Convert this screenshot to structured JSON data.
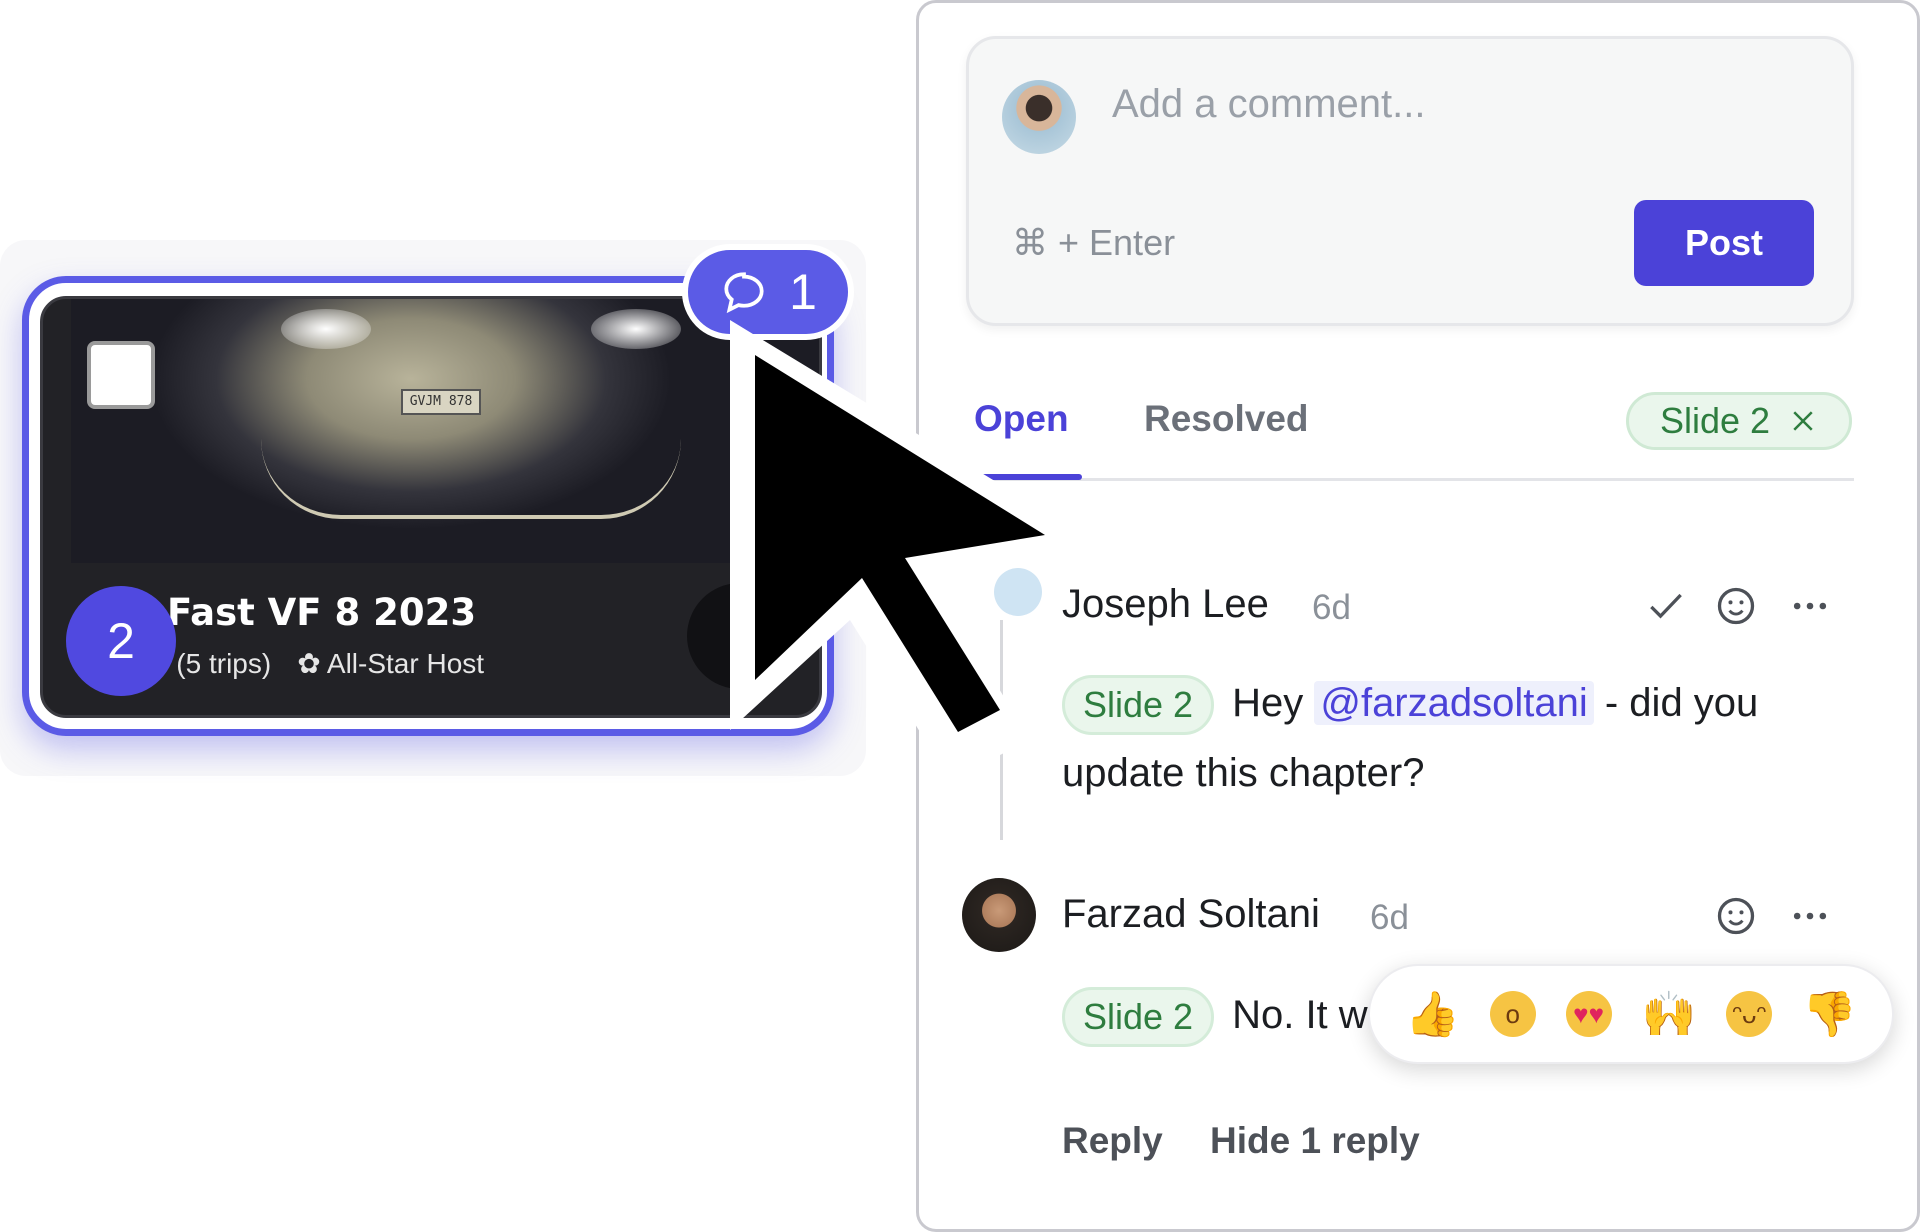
{
  "slide_card": {
    "title": "Fast VF 8 2023",
    "trips": "(5 trips)",
    "host_badge": "All-Star Host",
    "license_plate": "GVJM 878",
    "slide_number": "2",
    "comment_count": "1",
    "accent_color": "#5b5be6"
  },
  "composer": {
    "placeholder": "Add a comment...",
    "shortcut": "⌘ + Enter",
    "post_label": "Post"
  },
  "tabs": {
    "open_label": "Open",
    "resolved_label": "Resolved",
    "filter_label": "Slide 2",
    "active": "Open"
  },
  "comments": [
    {
      "author": "Joseph Lee",
      "age": "6d",
      "slide_tag": "Slide 2",
      "text_before": "Hey",
      "mention": "@farzadsoltani",
      "text_after": "- did you update this chapter?"
    },
    {
      "author": "Farzad Soltani",
      "age": "6d",
      "slide_tag": "Slide 2",
      "text": "No. It w"
    }
  ],
  "reactions": [
    "thumbs-up",
    "surprised",
    "heart-eyes",
    "raised-hands",
    "tears-of-joy",
    "thumbs-down"
  ],
  "thread_actions": {
    "reply_label": "Reply",
    "hide_label": "Hide 1 reply"
  },
  "colors": {
    "primary": "#4b42d8",
    "tag_green": "#2e7d3f",
    "tag_bg": "#eaf6ec"
  }
}
